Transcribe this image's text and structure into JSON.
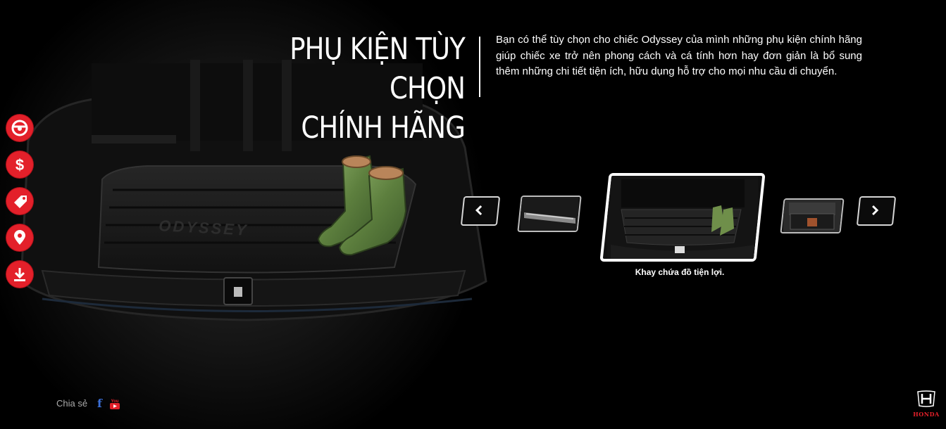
{
  "header": {
    "title_line1": "PHỤ KIỆN TÙY CHỌN",
    "title_line2": "CHÍNH HÃNG",
    "intro": "Bạn có thể tùy chọn cho chiếc Odyssey của mình những phụ kiện chính hãng giúp chiếc xe trở nên phong cách và cá tính hơn hay đơn giản là bổ sung thêm những chi tiết tiện ích, hữu dụng hỗ trợ cho mọi nhu cầu di chuyển."
  },
  "hero": {
    "mat_embossed_text": "ODYSSEY",
    "image_name": "trunk-tray-with-boots"
  },
  "sidebar": {
    "items": [
      {
        "icon": "steering-wheel-icon"
      },
      {
        "icon": "dollar-icon"
      },
      {
        "icon": "tag-icon"
      },
      {
        "icon": "location-pin-icon"
      },
      {
        "icon": "download-icon"
      }
    ]
  },
  "carousel": {
    "caption": "Khay chứa đồ tiện lợi.",
    "active_index": 1,
    "thumbnails": [
      {
        "name": "sill-plate-thumbnail"
      },
      {
        "name": "trunk-tray-thumbnail"
      },
      {
        "name": "cargo-organizer-thumbnail"
      }
    ]
  },
  "footer": {
    "share_label": "Chia sẻ",
    "facebook_glyph": "f",
    "youtube_label": "You",
    "brand": "HONDA"
  },
  "colors": {
    "accent": "#e3202a",
    "background": "#000000",
    "text": "#ffffff"
  }
}
